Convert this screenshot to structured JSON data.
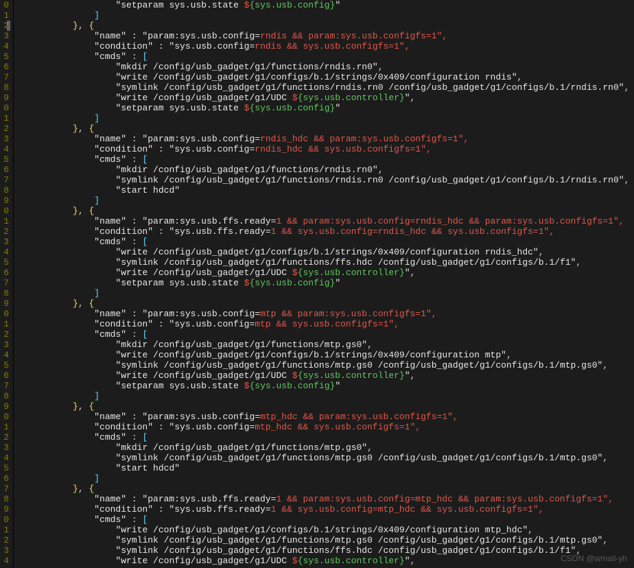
{
  "watermark": "CSDN @wmail-yh",
  "gutter": [
    "0",
    "1",
    "2",
    "3",
    "4",
    "5",
    "6",
    "7",
    "8",
    "9",
    "0",
    "1",
    "2",
    "3",
    "4",
    "5",
    "6",
    "7",
    "8",
    "9",
    "0",
    "1",
    "2",
    "3",
    "4",
    "5",
    "6",
    "7",
    "8",
    "9",
    "0",
    "1",
    "2",
    "3",
    "4",
    "5",
    "6",
    "7",
    "8",
    "9",
    "0",
    "1",
    "2",
    "3",
    "4",
    "5",
    "6",
    "7",
    "8",
    "9",
    "0",
    "1",
    "2",
    "3",
    "4"
  ],
  "cursor_line_index": 2,
  "groups": [
    {
      "preamble": [
        {
          "indent": 18,
          "segs": [
            {
              "c": "s-str",
              "t": "\"setparam sys.usb.state "
            },
            {
              "c": "s-red",
              "t": "$"
            },
            {
              "c": "s-green",
              "t": "{sys.usb.config}"
            },
            {
              "c": "s-str",
              "t": "\""
            }
          ]
        },
        {
          "indent": 14,
          "segs": [
            {
              "c": "s-bl",
              "t": "]"
            }
          ]
        },
        {
          "indent": 10,
          "segs": [
            {
              "c": "s-br",
              "t": "}"
            },
            {
              "c": "s-pl",
              "t": ", "
            },
            {
              "c": "s-br",
              "t": "{"
            }
          ]
        }
      ],
      "name_red": "rndis && param:sys.usb.configfs=1\",",
      "cond_red": "rndis && sys.usb.configfs=1\",",
      "cmds": [
        [
          {
            "c": "s-str",
            "t": "\"mkdir /config/usb_gadget/g1/functions/rndis.rn0\""
          },
          {
            "c": "s-pl",
            "t": ","
          }
        ],
        [
          {
            "c": "s-str",
            "t": "\"write /config/usb_gadget/g1/configs/b.1/strings/0x409/configuration rndis\""
          },
          {
            "c": "s-pl",
            "t": ","
          }
        ],
        [
          {
            "c": "s-str",
            "t": "\"symlink /config/usb_gadget/g1/functions/rndis.rn0 /config/usb_gadget/g1/configs/b.1/rndis.rn0\""
          },
          {
            "c": "s-pl",
            "t": ","
          }
        ],
        [
          {
            "c": "s-str",
            "t": "\"write /config/usb_gadget/g1/UDC "
          },
          {
            "c": "s-red",
            "t": "$"
          },
          {
            "c": "s-green",
            "t": "{sys.usb.controller}"
          },
          {
            "c": "s-str",
            "t": "\""
          },
          {
            "c": "s-pl",
            "t": ","
          }
        ],
        [
          {
            "c": "s-str",
            "t": "\"setparam sys.usb.state "
          },
          {
            "c": "s-red",
            "t": "$"
          },
          {
            "c": "s-green",
            "t": "{sys.usb.config}"
          },
          {
            "c": "s-str",
            "t": "\""
          }
        ]
      ]
    },
    {
      "name_red": "rndis_hdc && param:sys.usb.configfs=1\",",
      "cond_red": "rndis_hdc && sys.usb.configfs=1\",",
      "cmds": [
        [
          {
            "c": "s-str",
            "t": "\"mkdir /config/usb_gadget/g1/functions/rndis.rn0\""
          },
          {
            "c": "s-pl",
            "t": ","
          }
        ],
        [
          {
            "c": "s-str",
            "t": "\"symlink /config/usb_gadget/g1/functions/rndis.rn0 /config/usb_gadget/g1/configs/b.1/rndis.rn0\""
          },
          {
            "c": "s-pl",
            "t": ","
          }
        ],
        [
          {
            "c": "s-str",
            "t": "\"start hdcd\""
          }
        ]
      ]
    },
    {
      "name_pre": "\"name\" : \"param:sys.usb.ffs.ready=",
      "name_red": "1 && param:sys.usb.config=rndis_hdc && param:sys.usb.configfs=1\",",
      "cond_pre": "\"condition\" : \"sys.usb.ffs.ready=",
      "cond_red": "1 && sys.usb.config=rndis_hdc && sys.usb.configfs=1\",",
      "cmds": [
        [
          {
            "c": "s-str",
            "t": "\"write /config/usb_gadget/g1/configs/b.1/strings/0x409/configuration rndis_hdc\""
          },
          {
            "c": "s-pl",
            "t": ","
          }
        ],
        [
          {
            "c": "s-str",
            "t": "\"symlink /config/usb_gadget/g1/functions/ffs.hdc /config/usb_gadget/g1/configs/b.1/f1\""
          },
          {
            "c": "s-pl",
            "t": ","
          }
        ],
        [
          {
            "c": "s-str",
            "t": "\"write /config/usb_gadget/g1/UDC "
          },
          {
            "c": "s-red",
            "t": "$"
          },
          {
            "c": "s-green",
            "t": "{sys.usb.controller}"
          },
          {
            "c": "s-str",
            "t": "\""
          },
          {
            "c": "s-pl",
            "t": ","
          }
        ],
        [
          {
            "c": "s-str",
            "t": "\"setparam sys.usb.state "
          },
          {
            "c": "s-red",
            "t": "$"
          },
          {
            "c": "s-green",
            "t": "{sys.usb.config}"
          },
          {
            "c": "s-str",
            "t": "\""
          }
        ]
      ]
    },
    {
      "name_red": "mtp && param:sys.usb.configfs=1\",",
      "cond_red": "mtp && sys.usb.configfs=1\",",
      "cmds": [
        [
          {
            "c": "s-str",
            "t": "\"mkdir /config/usb_gadget/g1/functions/mtp.gs0\""
          },
          {
            "c": "s-pl",
            "t": ","
          }
        ],
        [
          {
            "c": "s-str",
            "t": "\"write /config/usb_gadget/g1/configs/b.1/strings/0x409/configuration mtp\""
          },
          {
            "c": "s-pl",
            "t": ","
          }
        ],
        [
          {
            "c": "s-str",
            "t": "\"symlink /config/usb_gadget/g1/functions/mtp.gs0 /config/usb_gadget/g1/configs/b.1/mtp.gs0\""
          },
          {
            "c": "s-pl",
            "t": ","
          }
        ],
        [
          {
            "c": "s-str",
            "t": "\"write /config/usb_gadget/g1/UDC "
          },
          {
            "c": "s-red",
            "t": "$"
          },
          {
            "c": "s-green",
            "t": "{sys.usb.controller}"
          },
          {
            "c": "s-str",
            "t": "\""
          },
          {
            "c": "s-pl",
            "t": ","
          }
        ],
        [
          {
            "c": "s-str",
            "t": "\"setparam sys.usb.state "
          },
          {
            "c": "s-red",
            "t": "$"
          },
          {
            "c": "s-green",
            "t": "{sys.usb.config}"
          },
          {
            "c": "s-str",
            "t": "\""
          }
        ]
      ]
    },
    {
      "name_red": "mtp_hdc && param:sys.usb.configfs=1\",",
      "cond_red": "mtp_hdc && sys.usb.configfs=1\",",
      "cmds": [
        [
          {
            "c": "s-str",
            "t": "\"mkdir /config/usb_gadget/g1/functions/mtp.gs0\""
          },
          {
            "c": "s-pl",
            "t": ","
          }
        ],
        [
          {
            "c": "s-str",
            "t": "\"symlink /config/usb_gadget/g1/functions/mtp.gs0 /config/usb_gadget/g1/configs/b.1/mtp.gs0\""
          },
          {
            "c": "s-pl",
            "t": ","
          }
        ],
        [
          {
            "c": "s-str",
            "t": "\"start hdcd\""
          }
        ]
      ]
    },
    {
      "name_pre": "\"name\" : \"param:sys.usb.ffs.ready=",
      "name_red": "1 && param:sys.usb.config=mtp_hdc && param:sys.usb.configfs=1\",",
      "cond_pre": "\"condition\" : \"sys.usb.ffs.ready=",
      "cond_red": "1 && sys.usb.config=mtp_hdc && sys.usb.configfs=1\",",
      "cmds": [
        [
          {
            "c": "s-str",
            "t": "\"write /config/usb_gadget/g1/configs/b.1/strings/0x409/configuration mtp_hdc\""
          },
          {
            "c": "s-pl",
            "t": ","
          }
        ],
        [
          {
            "c": "s-str",
            "t": "\"symlink /config/usb_gadget/g1/functions/mtp.gs0 /config/usb_gadget/g1/configs/b.1/mtp.gs0\""
          },
          {
            "c": "s-pl",
            "t": ","
          }
        ],
        [
          {
            "c": "s-str",
            "t": "\"symlink /config/usb_gadget/g1/functions/ffs.hdc /config/usb_gadget/g1/configs/b.1/f1\""
          },
          {
            "c": "s-pl",
            "t": ","
          }
        ],
        [
          {
            "c": "s-str",
            "t": "\"write /config/usb_gadget/g1/UDC "
          },
          {
            "c": "s-red",
            "t": "$"
          },
          {
            "c": "s-green",
            "t": "{sys.usb.controller}"
          },
          {
            "c": "s-str",
            "t": "\""
          },
          {
            "c": "s-pl",
            "t": ","
          }
        ]
      ],
      "no_close": true
    }
  ]
}
